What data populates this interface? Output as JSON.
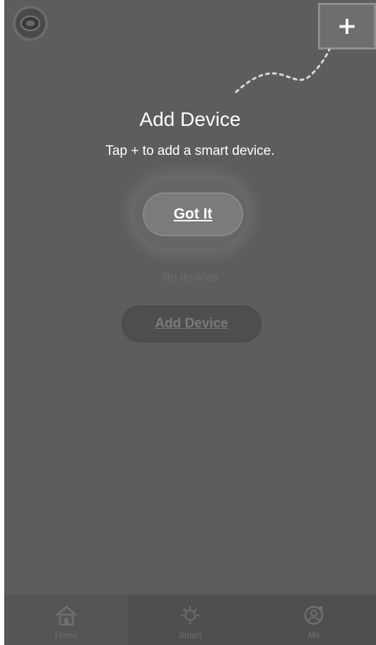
{
  "coach_mark": {
    "title": "Add Device",
    "description": "Tap + to add a smart device.",
    "got_it_label": "Got It",
    "plus_symbol": "+"
  },
  "main": {
    "empty_state_text": "No devices",
    "add_device_label": "Add Device"
  },
  "tabbar": {
    "tabs": [
      {
        "label": "Home",
        "icon": "home-icon",
        "active": true
      },
      {
        "label": "Smart",
        "icon": "smart-icon",
        "active": false
      },
      {
        "label": "Me",
        "icon": "profile-icon",
        "active": false
      }
    ]
  },
  "colors": {
    "overlay": "#5d5d5d",
    "text_on_overlay": "#ffffff"
  }
}
